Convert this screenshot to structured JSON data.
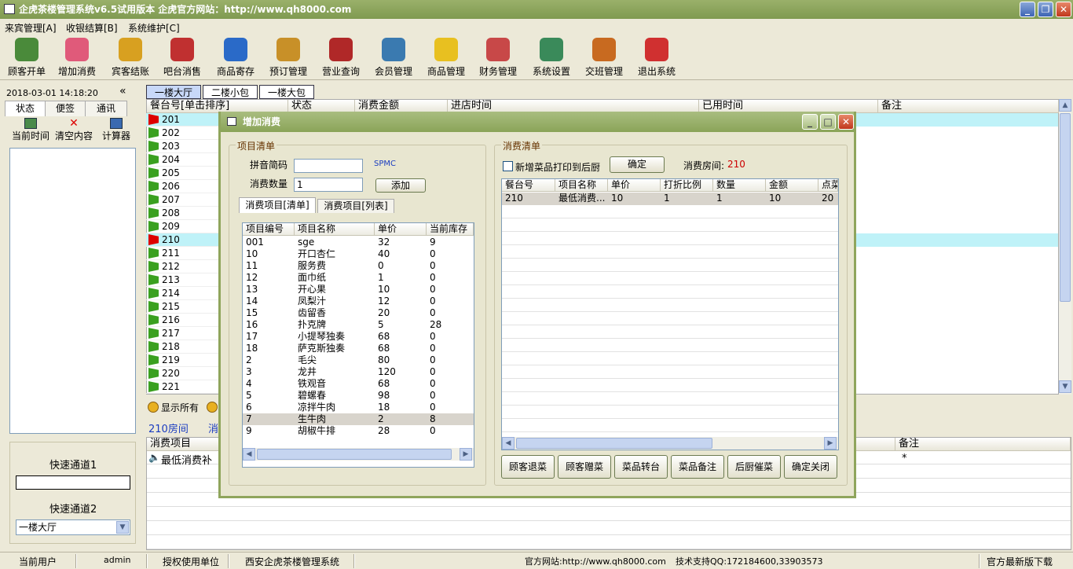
{
  "window": {
    "title": "企虎茶楼管理系统v6.5试用版本 企虎官方网站：http://www.qh8000.com"
  },
  "menu": [
    "来宾管理[A]",
    "收银结算[B]",
    "系统维护[C]"
  ],
  "toolbar": [
    {
      "label": "顾客开单",
      "icon": "cup-icon",
      "color": "#4a8a3a"
    },
    {
      "label": "增加消费",
      "icon": "add-icon",
      "color": "#e05a7a"
    },
    {
      "label": "宾客结账",
      "icon": "checkout-icon",
      "color": "#d8a020"
    },
    {
      "label": "吧台消售",
      "icon": "bar-icon",
      "color": "#c03030"
    },
    {
      "label": "商品寄存",
      "icon": "basket-icon",
      "color": "#2a6ac8"
    },
    {
      "label": "预订管理",
      "icon": "clock-icon",
      "color": "#c89028"
    },
    {
      "label": "营业查询",
      "icon": "report-icon",
      "color": "#b02828"
    },
    {
      "label": "会员管理",
      "icon": "members-icon",
      "color": "#3a7ab0"
    },
    {
      "label": "商品管理",
      "icon": "star-icon",
      "color": "#e8c020"
    },
    {
      "label": "财务管理",
      "icon": "finance-icon",
      "color": "#c84848"
    },
    {
      "label": "系统设置",
      "icon": "settings-icon",
      "color": "#3a8a5a"
    },
    {
      "label": "交班管理",
      "icon": "shift-icon",
      "color": "#c86a20"
    },
    {
      "label": "退出系统",
      "icon": "power-icon",
      "color": "#d03030"
    }
  ],
  "left": {
    "datetime": "2018-03-01 14:18:20",
    "collapse": "«",
    "tabs": [
      "状态",
      "便签",
      "通讯"
    ],
    "tools": [
      {
        "label": "当前时间"
      },
      {
        "label": "清空内容"
      },
      {
        "label": "计算器"
      }
    ],
    "channel1_label": "快速通道1",
    "channel1_value": "",
    "channel2_label": "快速通道2",
    "channel2_value": "一楼大厅"
  },
  "floors": [
    "一楼大厅",
    "二楼小包",
    "一楼大包"
  ],
  "main": {
    "headers": [
      "餐台号[单击排序]",
      "状态",
      "消费金额",
      "进店时间",
      "已用时间",
      "备注"
    ],
    "rooms": [
      {
        "no": "201",
        "red": true
      },
      {
        "no": "202",
        "red": false
      },
      {
        "no": "203",
        "red": false
      },
      {
        "no": "204",
        "red": false
      },
      {
        "no": "205",
        "red": false
      },
      {
        "no": "206",
        "red": false
      },
      {
        "no": "207",
        "red": false
      },
      {
        "no": "208",
        "red": false
      },
      {
        "no": "209",
        "red": false
      },
      {
        "no": "210",
        "red": true
      },
      {
        "no": "211",
        "red": false
      },
      {
        "no": "212",
        "red": false
      },
      {
        "no": "213",
        "red": false
      },
      {
        "no": "214",
        "red": false
      },
      {
        "no": "215",
        "red": false
      },
      {
        "no": "216",
        "red": false
      },
      {
        "no": "217",
        "red": false
      },
      {
        "no": "218",
        "red": false
      },
      {
        "no": "219",
        "red": false
      },
      {
        "no": "220",
        "red": false
      },
      {
        "no": "221",
        "red": false
      }
    ],
    "show_all": "显示所有",
    "room_info": "210房间",
    "room_info2": "消",
    "bottom_headers": [
      "消费项目",
      "备注"
    ],
    "bottom_row": {
      "item": "最低消费补",
      "note": "*"
    }
  },
  "dialog": {
    "title": "增加消费",
    "left_group": "项目清单",
    "pinyin_label": "拼音简码",
    "pinyin_value": "",
    "spmc": "SPMC",
    "qty_label": "消费数量",
    "qty_value": "1",
    "add_btn": "添加",
    "tabs": [
      "消费项目[清单]",
      "消费项目[列表]"
    ],
    "item_headers": [
      "项目编号",
      "项目名称",
      "单价",
      "当前库存"
    ],
    "items": [
      {
        "code": "001",
        "name": "sge",
        "price": "32",
        "stock": "9"
      },
      {
        "code": "10",
        "name": "开口杏仁",
        "price": "40",
        "stock": "0"
      },
      {
        "code": "11",
        "name": "服务费",
        "price": "0",
        "stock": "0"
      },
      {
        "code": "12",
        "name": "面巾纸",
        "price": "1",
        "stock": "0"
      },
      {
        "code": "13",
        "name": "开心果",
        "price": "10",
        "stock": "0"
      },
      {
        "code": "14",
        "name": "凤梨汁",
        "price": "12",
        "stock": "0"
      },
      {
        "code": "15",
        "name": "齿留香",
        "price": "20",
        "stock": "0"
      },
      {
        "code": "16",
        "name": "扑克牌",
        "price": "5",
        "stock": "28"
      },
      {
        "code": "17",
        "name": "小提琴独奏",
        "price": "68",
        "stock": "0"
      },
      {
        "code": "18",
        "name": "萨克斯独奏",
        "price": "68",
        "stock": "0"
      },
      {
        "code": "2",
        "name": "毛尖",
        "price": "80",
        "stock": "0"
      },
      {
        "code": "3",
        "name": "龙井",
        "price": "120",
        "stock": "0"
      },
      {
        "code": "4",
        "name": "铁观音",
        "price": "68",
        "stock": "0"
      },
      {
        "code": "5",
        "name": "碧螺春",
        "price": "98",
        "stock": "0"
      },
      {
        "code": "6",
        "name": "凉拌牛肉",
        "price": "18",
        "stock": "0"
      },
      {
        "code": "7",
        "name": "生牛肉",
        "price": "2",
        "stock": "8"
      },
      {
        "code": "9",
        "name": "胡椒牛排",
        "price": "28",
        "stock": "0"
      }
    ],
    "right_group": "消费清单",
    "print_label": "新增菜品打印到后厨",
    "confirm_btn": "确定",
    "room_label": "消费房间:",
    "room_value": "210",
    "bill_headers": [
      "餐台号",
      "项目名称",
      "单价",
      "打折比例",
      "数量",
      "金额",
      "点菜"
    ],
    "bill_rows": [
      {
        "room": "210",
        "name": "最低消费...",
        "price": "10",
        "discount": "1",
        "qty": "1",
        "amount": "10",
        "order": "20"
      }
    ],
    "buttons": [
      "顾客退菜",
      "顾客赠菜",
      "菜品转台",
      "菜品备注",
      "后厨催菜",
      "确定关闭"
    ],
    "accent": "#cc0000"
  },
  "status": {
    "user_label": "当前用户",
    "user": "admin",
    "unit_label": "授权使用单位",
    "unit": "西安企虎茶楼管理系统",
    "website": "官方网站:http://www.qh8000.com",
    "support": "技术支持QQ:172184600,33903573",
    "download": "官方最新版下载"
  }
}
